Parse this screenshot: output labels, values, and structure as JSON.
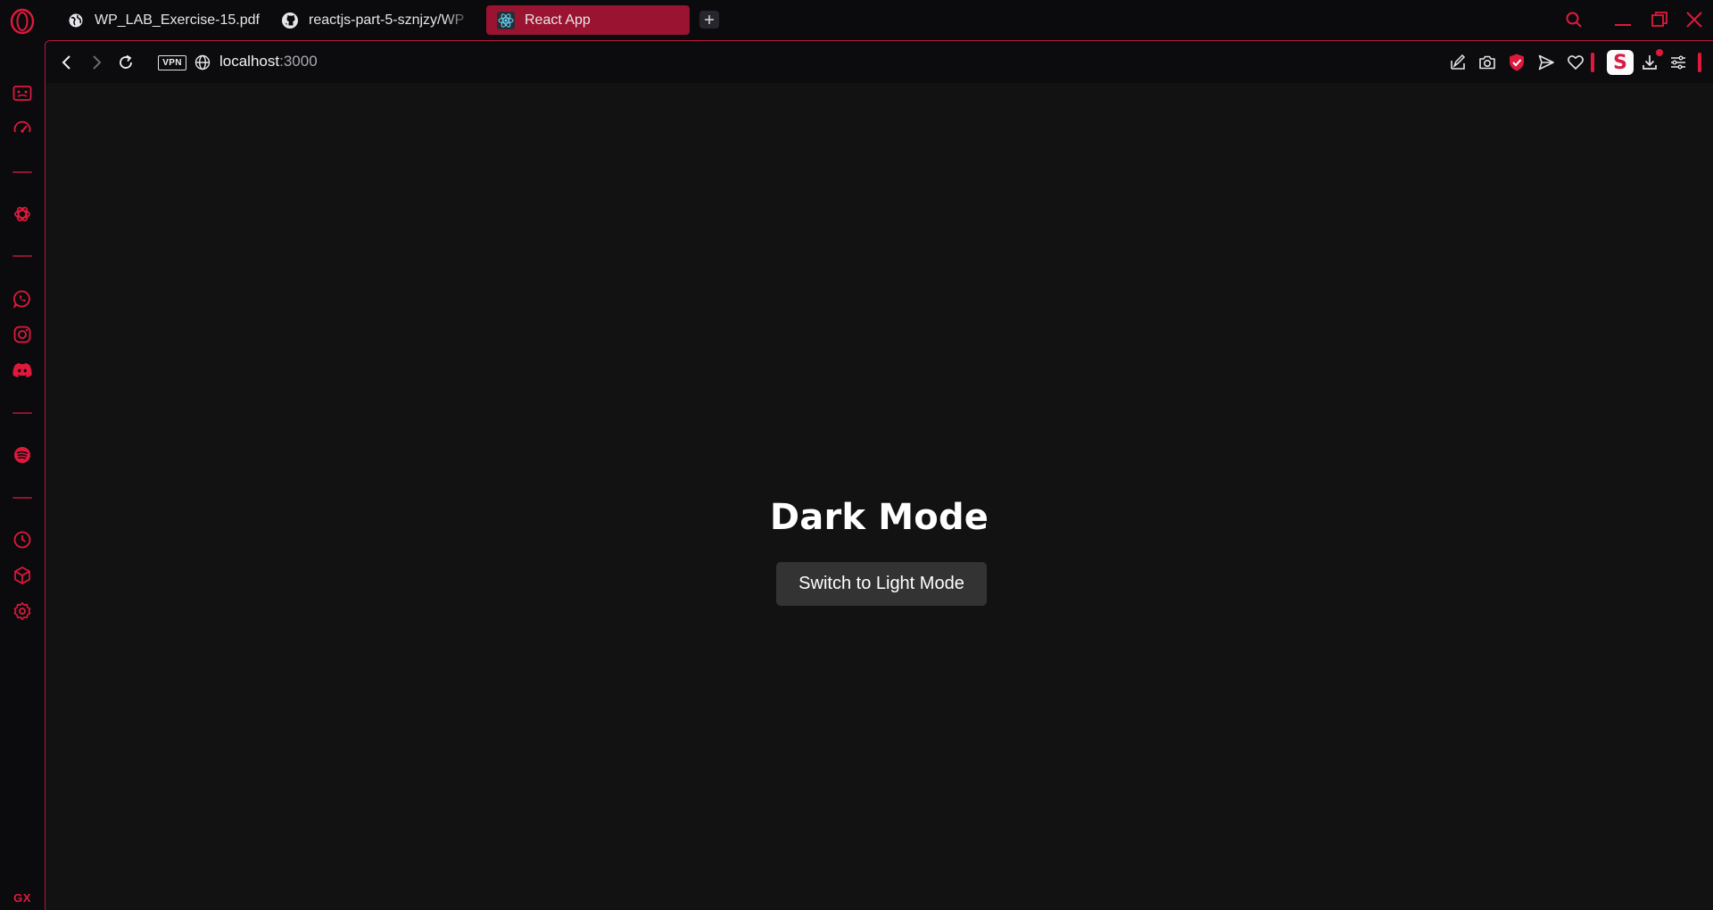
{
  "browser": {
    "name": "Opera GX",
    "accent_color": "#e0193c",
    "tabs": [
      {
        "title": "WP_LAB_Exercise-15.pdf",
        "icon": "globe-icon",
        "active": false
      },
      {
        "title": "reactjs-part-5-sznjzy/WP",
        "icon": "github-icon",
        "active": false
      },
      {
        "title": "React App",
        "icon": "react-icon",
        "active": true
      }
    ],
    "address": {
      "vpn_label": "VPN",
      "host": "localhost",
      "port": ":3000"
    },
    "sidebar": {
      "items": [
        "gx-corner-icon",
        "speed-dial-icon",
        "chatgpt-icon",
        "whatsapp-icon",
        "instagram-icon",
        "discord-icon",
        "spotify-icon",
        "history-icon",
        "extensions-icon",
        "settings-icon"
      ],
      "gx_label": "GX"
    },
    "toolbar_icons": [
      "snap-icon",
      "camera-icon",
      "adblock-shield-icon",
      "send-icon",
      "heart-icon",
      "extension-s-icon",
      "download-icon",
      "easy-setup-icon"
    ],
    "extension_letter": "S"
  },
  "page": {
    "heading": "Dark Mode",
    "button_label": "Switch to Light Mode",
    "background": "#121212",
    "button_color": "#333333"
  }
}
